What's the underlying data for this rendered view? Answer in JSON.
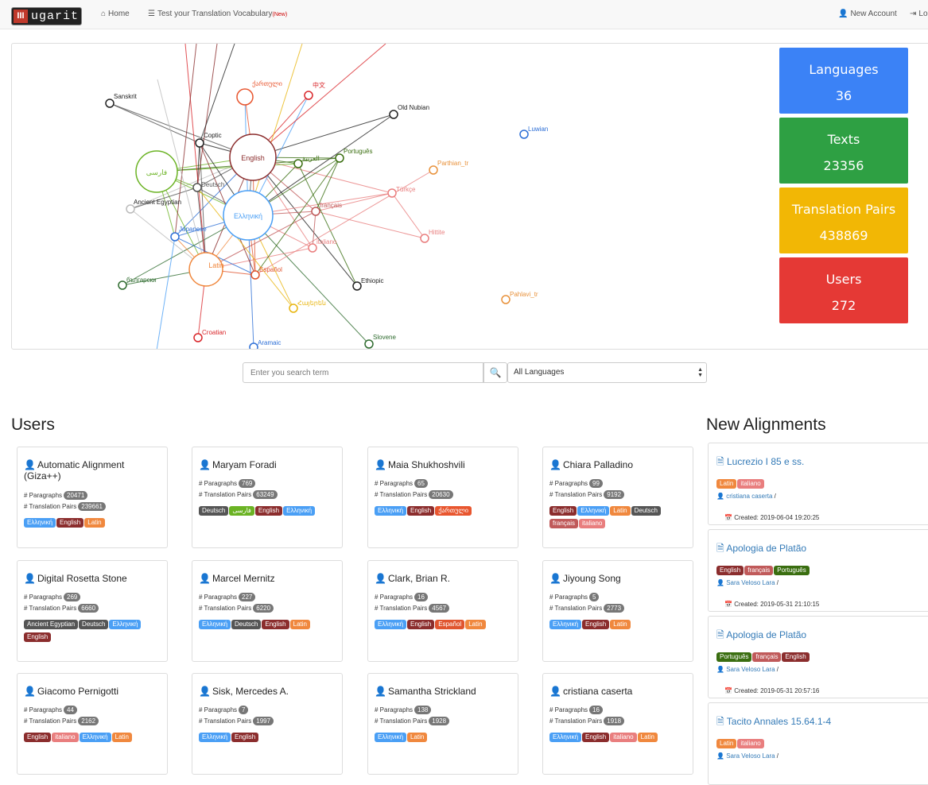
{
  "nav": {
    "brand": "ugarit",
    "home": "Home",
    "test": "Test your Translation Vocabulary",
    "test_badge": "(New)",
    "new_account": "New Account",
    "login": "Login"
  },
  "stats": [
    {
      "label": "Languages",
      "value": "36",
      "color": "#3b82f6"
    },
    {
      "label": "Texts",
      "value": "23356",
      "color": "#2ea043"
    },
    {
      "label": "Translation Pairs",
      "value": "438869",
      "color": "#f2b705"
    },
    {
      "label": "Users",
      "value": "272",
      "color": "#e53935"
    }
  ],
  "search": {
    "placeholder": "Enter you search term",
    "select": "All Languages"
  },
  "users_title": "Users",
  "alignments_title": "New Alignments",
  "lang_colors": {
    "Ελληνική": "#4a9ff5",
    "English": "#8b2d2d",
    "Latin": "#f0883e",
    "Deutsch": "#555555",
    "فارسی": "#6bb324",
    "ქართული": "#e8562f",
    "Español": "#e0552f",
    "Ancient Egyptian": "#555555",
    "français": "#c05a5a",
    "italiano": "#e97e7e",
    "Português": "#3a6e10"
  },
  "users": [
    {
      "name": "Automatic Alignment (Giza++)",
      "paragraphs": "20471",
      "pairs": "239661",
      "langs": [
        "Ελληνική",
        "English",
        "Latin"
      ]
    },
    {
      "name": "Maryam Foradi",
      "paragraphs": "769",
      "pairs": "63249",
      "langs": [
        "Deutsch",
        "فارسی",
        "English",
        "Ελληνική"
      ]
    },
    {
      "name": "Maia Shukhoshvili",
      "paragraphs": "65",
      "pairs": "20630",
      "langs": [
        "Ελληνική",
        "English",
        "ქართული"
      ]
    },
    {
      "name": "Chiara Palladino",
      "paragraphs": "99",
      "pairs": "9192",
      "langs": [
        "English",
        "Ελληνική",
        "Latin",
        "Deutsch",
        "français",
        "italiano"
      ]
    },
    {
      "name": "Digital Rosetta Stone",
      "paragraphs": "269",
      "pairs": "6660",
      "langs": [
        "Ancient Egyptian",
        "Deutsch",
        "Ελληνική",
        "English"
      ]
    },
    {
      "name": "Marcel Mernitz",
      "paragraphs": "227",
      "pairs": "6220",
      "langs": [
        "Ελληνική",
        "Deutsch",
        "English",
        "Latin"
      ]
    },
    {
      "name": "Clark, Brian R.",
      "paragraphs": "16",
      "pairs": "4567",
      "langs": [
        "Ελληνική",
        "English",
        "Español",
        "Latin"
      ]
    },
    {
      "name": "Jiyoung Song",
      "paragraphs": "5",
      "pairs": "2773",
      "langs": [
        "Ελληνική",
        "English",
        "Latin"
      ]
    },
    {
      "name": "Giacomo Pernigotti",
      "paragraphs": "44",
      "pairs": "2162",
      "langs": [
        "English",
        "italiano",
        "Ελληνική",
        "Latin"
      ]
    },
    {
      "name": "Sisk, Mercedes A.",
      "paragraphs": "7",
      "pairs": "1997",
      "langs": [
        "Ελληνική",
        "English"
      ]
    },
    {
      "name": "Samantha Strickland",
      "paragraphs": "138",
      "pairs": "1928",
      "langs": [
        "Ελληνική",
        "Latin"
      ]
    },
    {
      "name": "cristiana caserta",
      "paragraphs": "16",
      "pairs": "1918",
      "langs": [
        "Ελληνική",
        "English",
        "italiano",
        "Latin"
      ]
    }
  ],
  "labels": {
    "paragraphs": "# Paragraphs",
    "pairs": "# Translation Pairs"
  },
  "alignments": [
    {
      "title": "Lucrezio I 85 e ss.",
      "langs": [
        "Latin",
        "italiano"
      ],
      "user": "cristiana caserta",
      "created": "Created: 2019-06-04 19:20:25"
    },
    {
      "title": "Apologia de Platão",
      "langs": [
        "English",
        "français",
        "Português"
      ],
      "user": "Sara Veloso Lara",
      "created": "Created: 2019-05-31 21:10:15"
    },
    {
      "title": "Apologia de Platão",
      "langs": [
        "Português",
        "français",
        "English"
      ],
      "user": "Sara Veloso Lara",
      "created": "Created: 2019-05-31 20:57:16"
    },
    {
      "title": "Tacito Annales 15.64.1-4",
      "langs": [
        "Latin",
        "italiano"
      ],
      "user": "Sara Veloso Lara",
      "created": ""
    }
  ],
  "graph": {
    "nodes": [
      {
        "id": "English",
        "label": "English",
        "color": "#8b2d2d",
        "label_color": "#8b2d2d"
      },
      {
        "id": "Greek",
        "label": "Ελληνική",
        "color": "#4a9ff5",
        "label_color": "#4a9ff5"
      },
      {
        "id": "Latin",
        "label": "Latin",
        "color": "#f0883e",
        "label_color": "#f0883e"
      },
      {
        "id": "Persian",
        "label": "فارسی",
        "color": "#6bb324",
        "label_color": "#6bb324"
      },
      {
        "id": "Georgian",
        "label": "ქართული",
        "color": "#e8562f",
        "label_color": "#e8562f"
      },
      {
        "id": "Chinese",
        "label": "中文",
        "color": "#d9262a",
        "label_color": "#d9262a"
      },
      {
        "id": "Sanskrit",
        "label": "Sanskrit",
        "color": "#222",
        "label_color": "#222"
      },
      {
        "id": "Coptic",
        "label": "Coptic",
        "color": "#222",
        "label_color": "#222"
      },
      {
        "id": "OldNubian",
        "label": "Old Nubian",
        "color": "#222",
        "label_color": "#222"
      },
      {
        "id": "Arabic",
        "label": "العربية",
        "color": "#3a6e10",
        "label_color": "#3a6e10"
      },
      {
        "id": "Portuguese",
        "label": "Português",
        "color": "#3a6e10",
        "label_color": "#3a6e10"
      },
      {
        "id": "Deutsch",
        "label": "Deutsch",
        "color": "#555",
        "label_color": "#555"
      },
      {
        "id": "AncientEgyptian",
        "label": "Ancient Egyptian",
        "color": "#bbb",
        "label_color": "#222"
      },
      {
        "id": "Parthian",
        "label": "Parthian_tr",
        "color": "#e8913a",
        "label_color": "#e8913a"
      },
      {
        "id": "Turkish",
        "label": "Türkçe",
        "color": "#e97e7e",
        "label_color": "#e97e7e"
      },
      {
        "id": "French",
        "label": "français",
        "color": "#c05a5a",
        "label_color": "#c05a5a"
      },
      {
        "id": "Japanese",
        "label": "Japanese",
        "color": "#2d6fd6",
        "label_color": "#2d6fd6"
      },
      {
        "id": "Hittite",
        "label": "Hittite",
        "color": "#e97e7e",
        "label_color": "#e97e7e"
      },
      {
        "id": "Italian",
        "label": "italiano",
        "color": "#e97e7e",
        "label_color": "#e97e7e"
      },
      {
        "id": "Spanish",
        "label": "Español",
        "color": "#e0552f",
        "label_color": "#e0552f"
      },
      {
        "id": "Bulgarian",
        "label": "български",
        "color": "#2e6b2e",
        "label_color": "#2e6b2e"
      },
      {
        "id": "Ethiopic",
        "label": "Ethiopic",
        "color": "#222",
        "label_color": "#222"
      },
      {
        "id": "Armenian",
        "label": "Հայերեն",
        "color": "#e8b50f",
        "label_color": "#e8b50f"
      },
      {
        "id": "Pahlavi",
        "label": "Pahlavi_tr",
        "color": "#e8913a",
        "label_color": "#e8913a"
      },
      {
        "id": "Croatian",
        "label": "Croatian",
        "color": "#d9262a",
        "label_color": "#d9262a"
      },
      {
        "id": "Aramaic",
        "label": "Aramaic",
        "color": "#2d6fd6",
        "label_color": "#2d6fd6"
      },
      {
        "id": "Slovene",
        "label": "Slovene",
        "color": "#2e6b2e",
        "label_color": "#2e6b2e"
      },
      {
        "id": "Luwian",
        "label": "Luwian",
        "color": "#2d6fd6",
        "label_color": "#2d6fd6"
      }
    ]
  }
}
